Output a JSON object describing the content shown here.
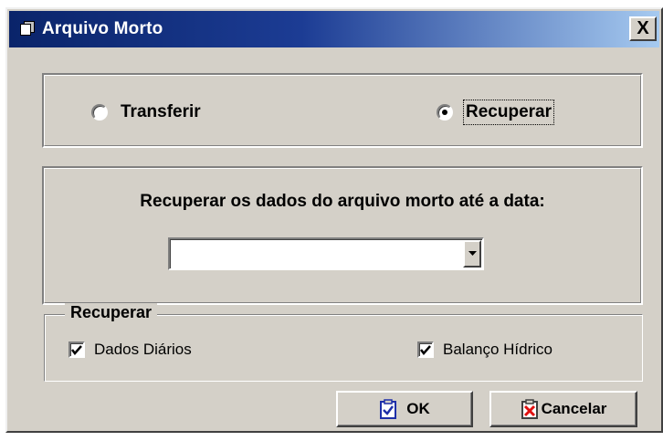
{
  "window": {
    "title": "Arquivo Morto",
    "icon": "folder-documents-icon",
    "close_label": "X"
  },
  "mode": {
    "options": [
      {
        "label": "Transferir",
        "selected": false
      },
      {
        "label": "Recuperar",
        "selected": true
      }
    ]
  },
  "date_section": {
    "prompt": "Recuperar os dados do arquivo morto até a data:",
    "selected_value": "",
    "dropdown_icon": "chevron-down-icon"
  },
  "recover_group": {
    "legend": "Recuperar",
    "checkboxes": [
      {
        "label": "Dados Diários",
        "checked": true
      },
      {
        "label": "Balanço Hídrico",
        "checked": true
      }
    ]
  },
  "buttons": {
    "ok_label": "OK",
    "ok_icon": "clipboard-check-icon",
    "cancel_label": "Cancelar",
    "cancel_icon": "clipboard-x-icon"
  },
  "colors": {
    "titlebar_start": "#0a246a",
    "titlebar_end": "#a6caf0",
    "face": "#d4d0c8",
    "ok_accent": "#1e2fa8",
    "cancel_accent": "#e01010"
  }
}
